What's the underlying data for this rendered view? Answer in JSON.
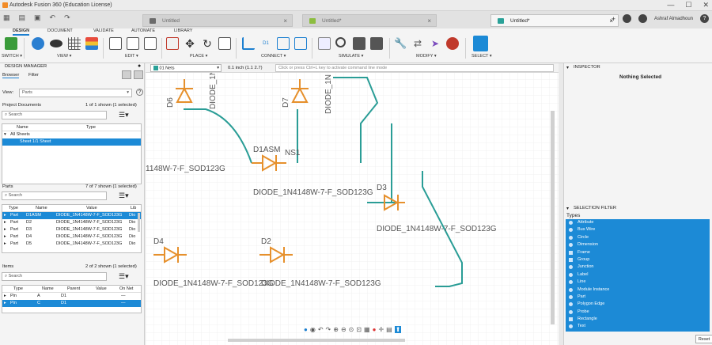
{
  "window": {
    "title": "Autodesk Fusion 360 (Education License)",
    "controls": [
      "—",
      "☐",
      "✕"
    ]
  },
  "doc_tabs": [
    {
      "label": "Untitled",
      "color": "#6b6b6b"
    },
    {
      "label": "Untitled*",
      "color": "#8cbd3f"
    },
    {
      "label": "Untitled*",
      "color": "#2aa198"
    }
  ],
  "user": {
    "name": "Ashraf Almadhoun",
    "help": "?"
  },
  "toolbar": {
    "tabs": [
      "DESIGN",
      "DOCUMENT",
      "VALIDATE",
      "AUTOMATE",
      "LIBRARY"
    ],
    "groups": [
      "SWITCH ▾",
      "VIEW ▾",
      "EDIT ▾",
      "PLACE ▾",
      "CONNECT ▾",
      "SIMULATE ▾",
      "MODIFY ▾",
      "SELECT ▾"
    ]
  },
  "design_manager": {
    "title": "DESIGN MANAGER",
    "tabs": [
      "Browser",
      "Filter"
    ],
    "view_label": "View:",
    "view_value": "Parts",
    "project_documents": {
      "title": "Project Documents",
      "count": "1 of 1 shown (1 selected)",
      "search_placeholder": "Search",
      "columns": [
        "Name",
        "Type"
      ],
      "rows": [
        "All Sheets",
        "Sheet 1/1 Sheet"
      ]
    },
    "parts": {
      "title": "Parts",
      "count": "7 of 7 shown (1 selected)",
      "search_placeholder": "Search",
      "columns": [
        "Type",
        "Name",
        "Value",
        "Lib"
      ],
      "rows": [
        {
          "type": "Part",
          "name": "D1ASM",
          "value": "DIODE_1N4148W-7-F_SOD123G",
          "lib": "Dio"
        },
        {
          "type": "Part",
          "name": "D2",
          "value": "DIODE_1N4148W-7-F_SOD123G",
          "lib": "Dio"
        },
        {
          "type": "Part",
          "name": "D3",
          "value": "DIODE_1N4148W-7-F_SOD123G",
          "lib": "Dio"
        },
        {
          "type": "Part",
          "name": "D4",
          "value": "DIODE_1N4148W-7-F_SOD123G",
          "lib": "Dio"
        },
        {
          "type": "Part",
          "name": "D5",
          "value": "DIODE_1N4148W-7-F_SOD123G",
          "lib": "Dio"
        }
      ]
    },
    "items": {
      "title": "Items",
      "count": "2 of 2 shown (1 selected)",
      "search_placeholder": "Search",
      "columns": [
        "Type",
        "Name",
        "Parent",
        "Value",
        "On Net"
      ],
      "rows": [
        {
          "type": "Pin",
          "name": "A",
          "parent": "D1",
          "value": "",
          "on_net": "—"
        },
        {
          "type": "Pin",
          "name": "C",
          "parent": "D1",
          "value": "",
          "on_net": "—"
        }
      ]
    }
  },
  "command_bar": {
    "nets": "01 Nets",
    "grid": "0.1 inch (1.1 2.7)",
    "placeholder": "Click or press Ctrl+L key to activate command line mode"
  },
  "schematic": {
    "labels": {
      "d6": "D6",
      "d6v": "DIODE_1N",
      "d7": "D7",
      "d7v": "DIODE_1N",
      "d1": "D1ASM",
      "ns1": "NS1",
      "d1v": "DIODE_1N4148W-7-F_SOD123G",
      "topv": "1148W-7-F_SOD123G",
      "d3": "D3",
      "d3v": "DIODE_1N4148W-7-F_SOD123G",
      "d4": "D4",
      "d4v": "DIODE_1N4148W-7-F_SOD123G",
      "d2": "D2",
      "d2v": "DIODE_1N4148W-7-F_SOD123G"
    },
    "colors": {
      "part": "#e6902c",
      "wire": "#2a9d96",
      "label": "#555555"
    }
  },
  "inspector": {
    "title": "INSPECTOR",
    "empty": "Nothing Selected"
  },
  "selection_filter": {
    "title": "SELECTION FILTER",
    "types_label": "Types",
    "items": [
      "Attribute",
      "Bus Wire",
      "Circle",
      "Dimension",
      "Frame",
      "Group",
      "Junction",
      "Label",
      "Line",
      "Module Instance",
      "Part",
      "Polygon Edge",
      "Probe",
      "Rectangle",
      "Text"
    ]
  },
  "bottom": {
    "reset": "Reset"
  }
}
